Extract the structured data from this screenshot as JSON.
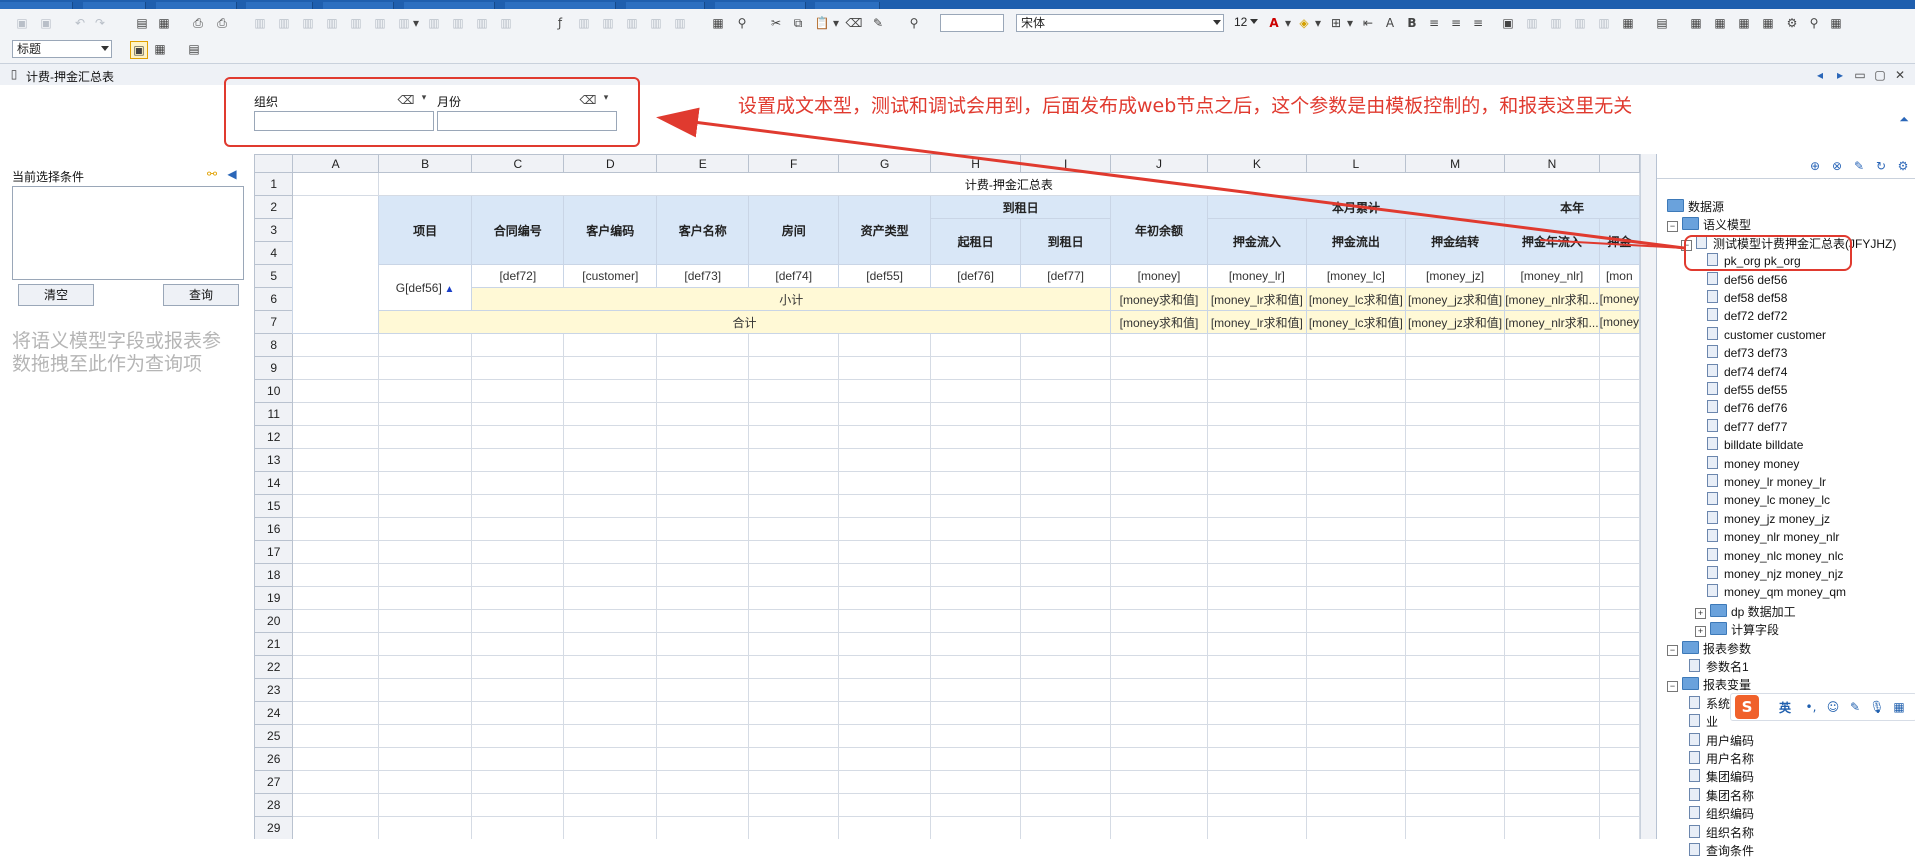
{
  "toolbar": {
    "font_name": "宋体",
    "font_size": "12",
    "style_select": "标题"
  },
  "doc_tab": {
    "title": "计费-押金汇总表"
  },
  "params": {
    "org_label": "组织",
    "month_label": "月份",
    "org_value": "",
    "month_value": ""
  },
  "annotation": "设置成文本型，测试和调试会用到，后面发布成web节点之后，这个参数是由模板控制的，和报表这里无关",
  "left_panel": {
    "title": "当前选择条件",
    "clear_button": "清空",
    "query_button": "查询",
    "hint": "将语义模型字段或报表参数拖拽至此作为查询项"
  },
  "sheet": {
    "columns": [
      "A",
      "B",
      "C",
      "D",
      "E",
      "F",
      "G",
      "H",
      "I",
      "J",
      "K",
      "L",
      "M",
      "N"
    ],
    "row_numbers": [
      "1",
      "2",
      "3",
      "4",
      "5",
      "6",
      "7",
      "8",
      "9",
      "10",
      "11",
      "12",
      "13",
      "14",
      "15",
      "16",
      "17",
      "18",
      "19",
      "20",
      "21",
      "22",
      "23",
      "24",
      "25",
      "26",
      "27",
      "28",
      "29"
    ],
    "title": "计费-押金汇总表",
    "headers": {
      "item": "项目",
      "contract": "合同编号",
      "cust_code": "客户编码",
      "cust_name": "客户名称",
      "room": "房间",
      "asset_type": "资产类型",
      "rent_date": "到租日",
      "start_date": "起租日",
      "end_date": "到租日",
      "opening": "年初余额",
      "month_total": "本月累计",
      "year_total": "本年",
      "dep_in": "押金流入",
      "dep_out": "押金流出",
      "dep_transfer": "押金结转",
      "dep_year_in": "押金年流入",
      "dep_trunc": "押金"
    },
    "row5": [
      "G[def56]",
      "[def72]",
      "[customer]",
      "[def73]",
      "[def74]",
      "[def55]",
      "[def76]",
      "[def77]",
      "[money]",
      "[money_lr]",
      "[money_lc]",
      "[money_jz]",
      "[money_nlr]",
      "[mon"
    ],
    "subtotal_label": "小计",
    "total_label": "合计",
    "sum_cells": [
      "[money求和值]",
      "[money_lr求和值]",
      "[money_lc求和值]",
      "[money_jz求和值]",
      "[money_nlr求和...",
      "[money"
    ]
  },
  "tree": {
    "root": "数据源",
    "semantic_model": "语义模型",
    "model_name": "测试模型计费押金汇总表(JFYJHZ)",
    "fields": [
      "pk_org  pk_org",
      "def56  def56",
      "def58  def58",
      "def72  def72",
      "customer  customer",
      "def73  def73",
      "def74  def74",
      "def55  def55",
      "def76  def76",
      "def77  def77",
      "billdate  billdate",
      "money  money",
      "money_lr  money_lr",
      "money_lc  money_lc",
      "money_jz  money_jz",
      "money_nlr  money_nlr",
      "money_nlc  money_nlc",
      "money_njz  money_njz",
      "money_qm  money_qm"
    ],
    "dp_folder": "dp  数据加工",
    "calc_folder": "计算字段",
    "report_params": "报表参数",
    "param1": "参数名1",
    "report_vars": "报表变量",
    "vars": [
      "系统日期",
      "业",
      "用户编码",
      "用户名称",
      "集团编码",
      "集团名称",
      "组织编码",
      "组织名称",
      "查询条件"
    ]
  },
  "ime": {
    "lang": "英",
    "logo": "S"
  },
  "colors": {
    "accent_red": "#e03a2f",
    "header_blue": "#d9e7f7",
    "subtotal_yellow": "#fff9d6",
    "menubar": "#1f5fae"
  }
}
